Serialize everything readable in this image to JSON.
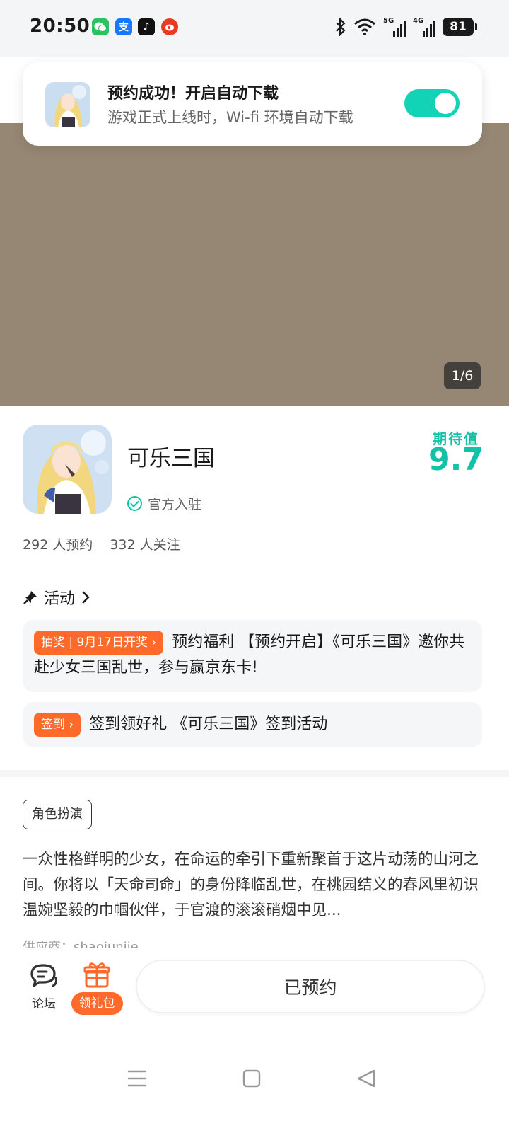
{
  "status_bar": {
    "time": "20:50",
    "net_5g": "5G",
    "net_4g": "4G",
    "battery": "81",
    "apps": [
      {
        "name": "wechat-icon",
        "glyph": "",
        "color": "#2bc25f"
      },
      {
        "name": "alipay-icon",
        "glyph": "支",
        "color": "#1677ff"
      },
      {
        "name": "tiktok-icon",
        "glyph": "♪",
        "color": "#111111"
      },
      {
        "name": "weibo-icon",
        "glyph": "",
        "color": "#ea3a1f"
      }
    ]
  },
  "toast": {
    "title": "预约成功！开启自动下载",
    "subtitle": "游戏正式上线时，Wi-fi 环境自动下载",
    "toggle_on": true
  },
  "banner": {
    "pager": "1/6",
    "color": "#968774"
  },
  "game": {
    "name": "可乐三国",
    "official_label": "官方入驻",
    "expect_label": "期待值",
    "expect_value": "9.7",
    "reservations": "292 人预约",
    "followers": "332 人关注"
  },
  "activities": {
    "header": "活动",
    "items": [
      {
        "tag": "抽奖 | 9月17日开奖",
        "text": "预约福利 【预约开启】《可乐三国》邀你共赴少女三国乱世，参与赢京东卡!"
      },
      {
        "tag": "签到",
        "text": "签到领好礼 《可乐三国》签到活动"
      }
    ]
  },
  "details": {
    "genre": "角色扮演",
    "description": "一众性格鲜明的少女，在命运的牵引下重新聚首于这片动荡的山河之间。你将以「天命司命」的身份降临乱世，在桃园结义的春风里初识温婉坚毅的巾帼伙伴，于官渡的滚滚硝烟中见...",
    "supplier": "供应商：shaojunjie"
  },
  "bottom_bar": {
    "forum_label": "论坛",
    "gift_label": "领礼包",
    "reserve_label": "已预约"
  },
  "colors": {
    "accent": "#12c2a6",
    "toggle": "#12d3b5",
    "orange": "#ff6a2b"
  }
}
